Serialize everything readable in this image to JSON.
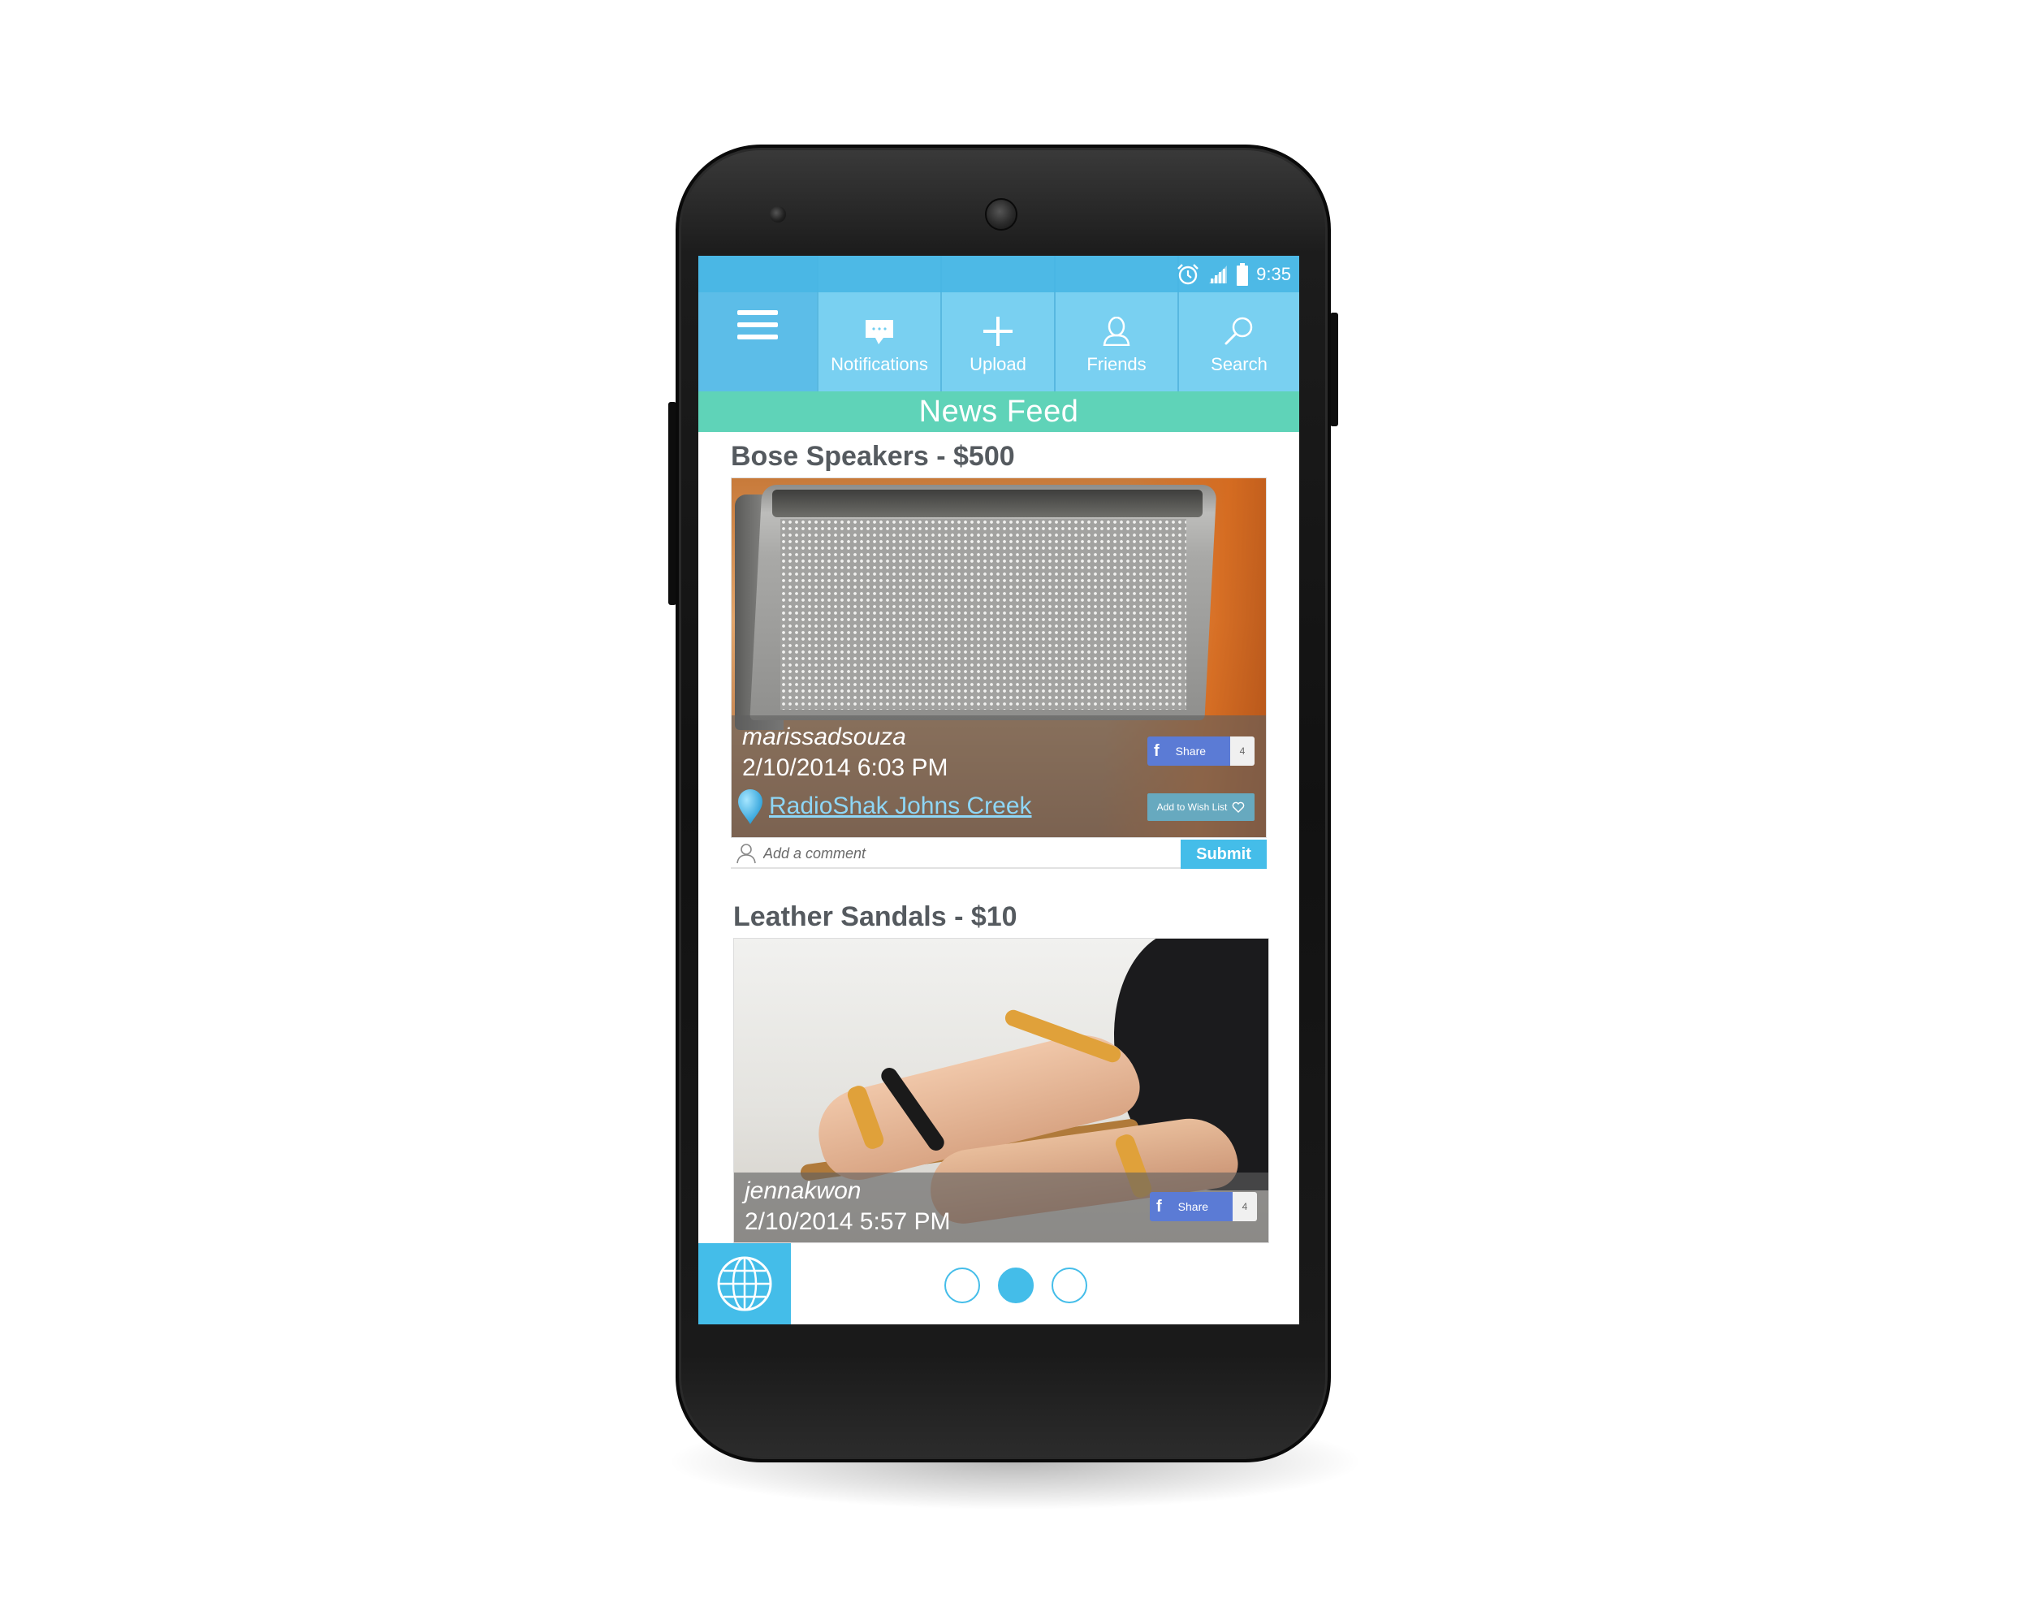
{
  "status_bar": {
    "time": "9:35"
  },
  "nav": {
    "items": [
      {
        "label": "Notifications",
        "icon": "chat-bubble-icon"
      },
      {
        "label": "Upload",
        "icon": "plus-icon"
      },
      {
        "label": "Friends",
        "icon": "person-icon"
      },
      {
        "label": "Search",
        "icon": "magnifier-icon"
      }
    ]
  },
  "section_title": "News Feed",
  "posts": [
    {
      "title": "Bose Speakers - $500",
      "user": "marissadsouza",
      "date": "2/10/2014 6:03 PM",
      "location": "RadioShak Johns Creek",
      "share_label": "Share",
      "share_count": "4",
      "wish_label": "Add to Wish List"
    },
    {
      "title": "Leather Sandals - $10",
      "user": "jennakwon",
      "date": "2/10/2014 5:57 PM",
      "share_label": "Share",
      "share_count": "4"
    }
  ],
  "comment": {
    "placeholder": "Add a comment",
    "submit_label": "Submit"
  },
  "pagination": {
    "total": 3,
    "active": 2
  },
  "colors": {
    "nav_blue": "#5cbde8",
    "section_teal": "#5fd3b8",
    "accent_blue": "#44bde9",
    "facebook_blue": "#5b7bd5",
    "link_blue": "#8ed6f6"
  }
}
